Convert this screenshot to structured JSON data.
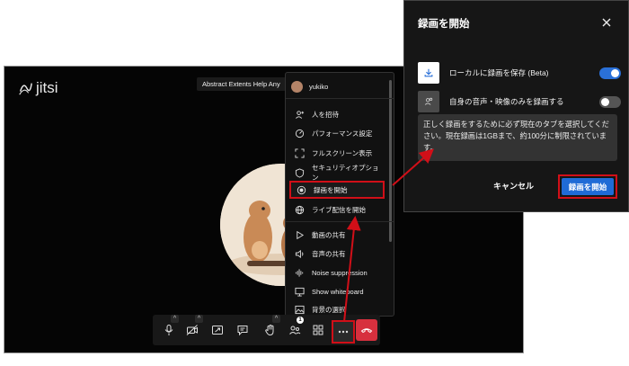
{
  "conference": {
    "logo_text": "jitsi",
    "room_title": "Abstract Extents Help Any"
  },
  "menu": {
    "user_name": "yukiko",
    "items": [
      {
        "label": "人を招待",
        "icon": "add-person-icon"
      },
      {
        "label": "パフォーマンス設定",
        "icon": "gauge-icon"
      },
      {
        "label": "フルスクリーン表示",
        "icon": "fullscreen-icon"
      },
      {
        "label": "セキュリティオプション",
        "icon": "shield-icon"
      },
      {
        "label": "録画を開始",
        "icon": "record-icon"
      },
      {
        "label": "ライブ配信を開始",
        "icon": "globe-icon"
      },
      {
        "label": "動画の共有",
        "icon": "play-icon"
      },
      {
        "label": "音声の共有",
        "icon": "speaker-icon"
      },
      {
        "label": "Noise suppression",
        "icon": "waveform-icon"
      },
      {
        "label": "Show whiteboard",
        "icon": "whiteboard-icon"
      },
      {
        "label": "背景の選択",
        "icon": "image-icon"
      }
    ]
  },
  "toolbar": {
    "participants_badge": "1",
    "caret": "^"
  },
  "dialog": {
    "title": "録画を開始",
    "option_local": "ローカルに録画を保存 (Beta)",
    "option_local_enabled": true,
    "option_self_only": "自身の音声・映像のみを録画する",
    "option_self_only_enabled": false,
    "notice": "正しく録画をするために必ず現在のタブを選択してください。現在録画は1GBまで、約100分に制限されています。",
    "cancel_label": "キャンセル",
    "start_label": "録画を開始"
  },
  "colors": {
    "highlight": "#d10f18",
    "accent": "#1f6bd6",
    "hangup": "#d7303e"
  }
}
